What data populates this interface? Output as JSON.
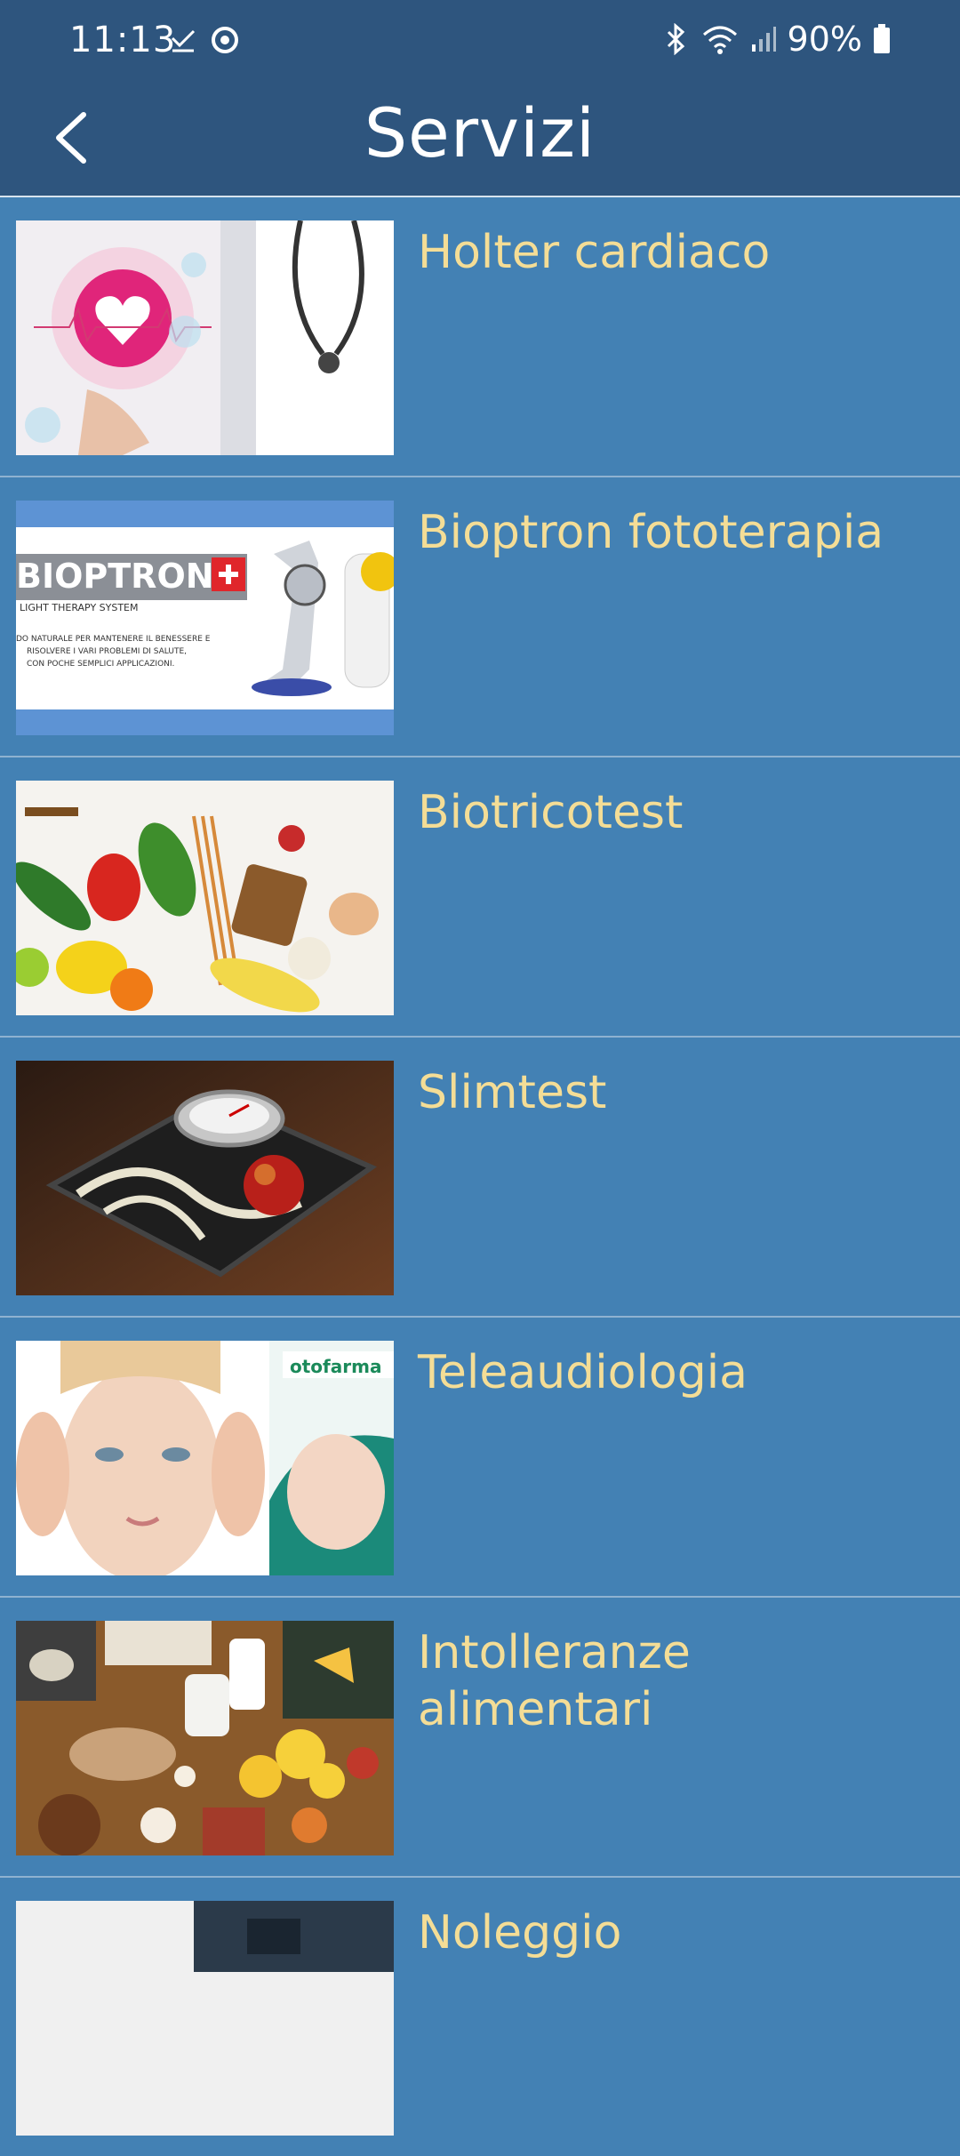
{
  "status_bar": {
    "time": "11:13",
    "battery": "90%",
    "icons": [
      "check-download-icon",
      "sync-icon",
      "bluetooth-icon",
      "wifi-icon",
      "signal-icon",
      "battery-icon"
    ]
  },
  "header": {
    "title": "Servizi",
    "back_icon": "chevron-left-icon"
  },
  "services": [
    {
      "title": "Holter cardiaco",
      "image": "doctor-heart-image"
    },
    {
      "title": "Bioptron fototerapia",
      "image": "bioptron-lamp-image",
      "image_text": [
        "BIOPTRON",
        "LIGHT THERAPY SYSTEM",
        "DO NATURALE PER MANTENERE IL BENESSERE E",
        "RISOLVERE I VARI PROBLEMI DI SALUTE,",
        "CON POCHE SEMPLICI APPLICAZIONI."
      ]
    },
    {
      "title": "Biotricotest",
      "image": "vegetables-image"
    },
    {
      "title": "Slimtest",
      "image": "scale-image"
    },
    {
      "title": "Teleaudiologia",
      "image": "woman-ears-image",
      "image_text": [
        "otofarma"
      ]
    },
    {
      "title": "Intolleranze alimentari",
      "image": "food-table-image"
    },
    {
      "title": "Noleggio",
      "image": "rental-image"
    }
  ],
  "colors": {
    "bar": "#2e557e",
    "background": "#4381b4",
    "item_title": "#f4dd96"
  }
}
